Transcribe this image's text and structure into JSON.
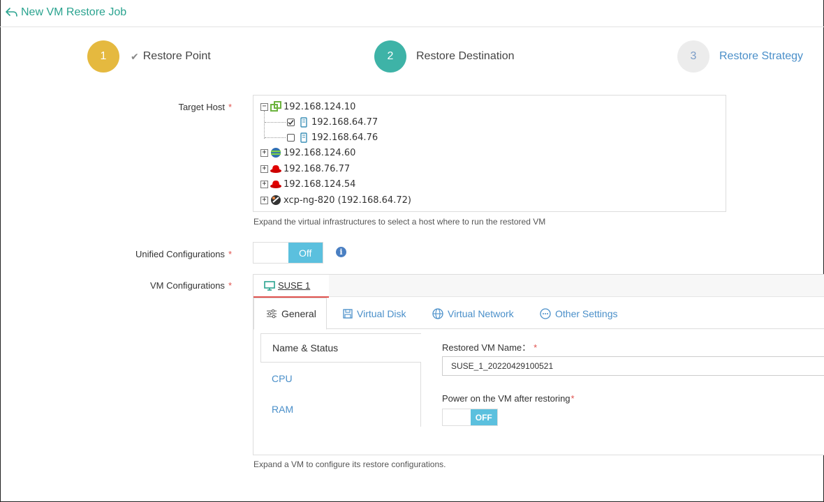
{
  "header": {
    "title": "New VM Restore Job"
  },
  "steps": [
    {
      "num": "1",
      "label": "Restore Point",
      "color": "#e5b93f",
      "done": true
    },
    {
      "num": "2",
      "label": "Restore Destination",
      "color": "#3eb3a7"
    },
    {
      "num": "3",
      "label": "Restore Strategy",
      "color": "#ececec"
    }
  ],
  "target_host": {
    "label": "Target Host",
    "required": "*",
    "tree": [
      {
        "name": "192.168.124.10",
        "icon": "vmware-icon",
        "expanded": true,
        "children": [
          {
            "name": "192.168.64.77",
            "icon": "server-icon",
            "checked": true
          },
          {
            "name": "192.168.64.76",
            "icon": "server-icon",
            "checked": false
          }
        ]
      },
      {
        "name": "192.168.124.60",
        "icon": "hyperv-icon"
      },
      {
        "name": "192.168.76.77",
        "icon": "redhat-icon"
      },
      {
        "name": "192.168.124.54",
        "icon": "redhat-icon"
      },
      {
        "name": "xcp-ng-820 (192.168.64.72)",
        "icon": "xcpng-icon"
      }
    ],
    "hint": "Expand the virtual infrastructures to select a host where to run the restored VM"
  },
  "unified": {
    "label": "Unified Configurations",
    "required": "*",
    "toggle": "Off"
  },
  "vm_config": {
    "label": "VM Configurations",
    "required": "*",
    "vm_tab": "SUSE 1",
    "subtabs": [
      "General",
      "Virtual Disk",
      "Virtual Network",
      "Other Settings"
    ],
    "side_items": [
      "Name & Status",
      "CPU",
      "RAM"
    ],
    "restored_name_label": "Restored VM Name：",
    "restored_name_required": "*",
    "restored_name_value": "SUSE_1_20220429100521",
    "power_label": "Power on the VM after restoring",
    "power_required": "*",
    "power_toggle": "OFF",
    "hint": "Expand a VM to configure its restore configurations."
  },
  "colors": {
    "accent": "#2aa38f",
    "link": "#4a8fc9",
    "toggle": "#5bc0de",
    "required": "#e0524e"
  }
}
